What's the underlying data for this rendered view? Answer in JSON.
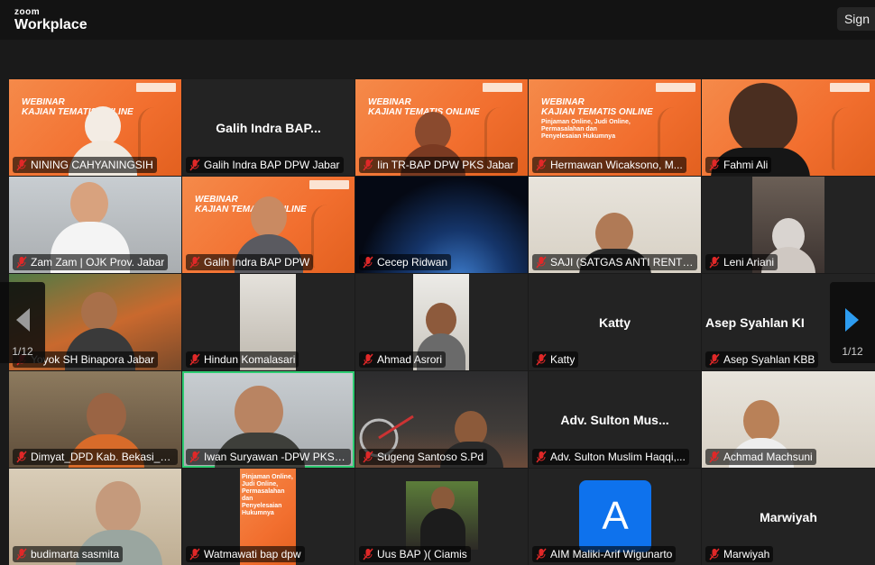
{
  "app": {
    "brand_top": "zoom",
    "brand_name": "Workplace",
    "sign_in": "Sign"
  },
  "webinar": {
    "title_line1": "WEBINAR",
    "title_line2": "KAJIAN TEMATIS ONLINE",
    "subtitle": "Pinjaman Online, Judi Online, Permasalahan dan Penyelesaian Hukumnya"
  },
  "tiles": [
    {
      "name": "NINING CAHYANINGSIH"
    },
    {
      "name": "Galih Indra BAP DPW Jabar",
      "center": "Galih Indra BAP..."
    },
    {
      "name": "Iin TR-BAP DPW PKS Jabar"
    },
    {
      "name": "Hermawan Wicaksono, M..."
    },
    {
      "name": "Fahmi Ali"
    },
    {
      "name": "Zam Zam | OJK Prov. Jabar"
    },
    {
      "name": "Galih Indra BAP DPW"
    },
    {
      "name": "Cecep Ridwan"
    },
    {
      "name": "SAJI (SATGAS ANTI RENTE..."
    },
    {
      "name": "Leni Ariani"
    },
    {
      "name": "Yoyok SH Binapora Jabar"
    },
    {
      "name": "Hindun Komalasari"
    },
    {
      "name": "Ahmad Asrori"
    },
    {
      "name": "Katty",
      "center": "Katty"
    },
    {
      "name": "Asep Syahlan KBB",
      "center": "Asep Syahlan KI"
    },
    {
      "name": "Dimyat_DPD Kab. Bekasi_Ja..."
    },
    {
      "name": "Iwan Suryawan -DPW PKS JAB..."
    },
    {
      "name": "Sugeng Santoso S.Pd"
    },
    {
      "name": "Adv. Sulton Muslim Haqqi,...",
      "center": "Adv. Sulton Mus..."
    },
    {
      "name": "Achmad Machsuni"
    },
    {
      "name": "budimarta sasmita"
    },
    {
      "name": "Watmawati bap dpw"
    },
    {
      "name": "Uus BAP )( Ciamis"
    },
    {
      "name": "AIM Maliki-Arif Wigunarto",
      "avatar_letter": "A"
    },
    {
      "name": "Marwiyah",
      "center": "Marwiyah"
    }
  ],
  "pager": {
    "left": "1/12",
    "right": "1/12"
  },
  "colors": {
    "accent_blue": "#0e72ed",
    "active_border": "#2ecc71",
    "muted_mic": "#e02828"
  }
}
